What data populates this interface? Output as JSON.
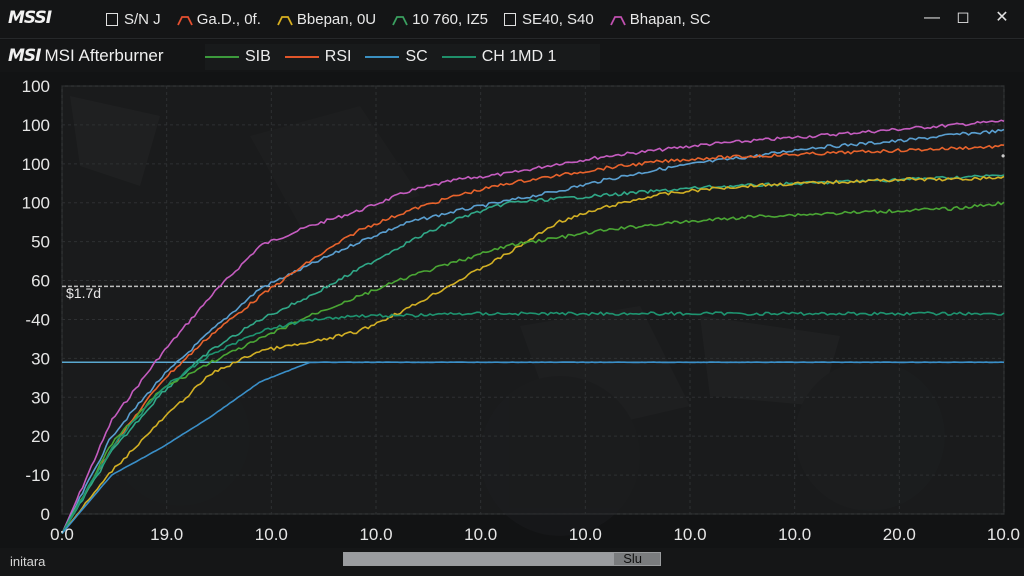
{
  "window": {
    "logo": "MSSI",
    "legend": [
      {
        "label": "S/N  J",
        "type": "box",
        "color": "#e0e0e0"
      },
      {
        "label": "Ga.D., 0f.",
        "type": "tick",
        "color": "#e65030"
      },
      {
        "label": "Bbepan, 0U",
        "type": "tick",
        "color": "#d8b020"
      },
      {
        "label": "10 760, IZ5",
        "type": "tick",
        "color": "#3aa060"
      },
      {
        "label": "SE40, S40",
        "type": "box",
        "color": "#e0e0e0"
      },
      {
        "label": "Bhapan, SC",
        "type": "tick",
        "color": "#c050b0"
      }
    ],
    "buttons": {
      "minimize": "—",
      "restore": "◻",
      "close": "✕"
    }
  },
  "subbar": {
    "brand_logo": "MSI",
    "brand_name": "MSI Afterburner",
    "legend": [
      {
        "label": "SIB",
        "color": "#3c9a3c"
      },
      {
        "label": "RSI",
        "color": "#e0552a"
      },
      {
        "label": "SC",
        "color": "#3a8fc0"
      },
      {
        "label": "CH   1MD 1",
        "color": "#1f8f6a"
      }
    ]
  },
  "chart_data": {
    "type": "line",
    "y_tick_labels": [
      "100",
      "100",
      "100",
      "100",
      "50",
      "60",
      "-40",
      "30",
      "30",
      "20",
      "-10",
      "0"
    ],
    "x_tick_labels": [
      "0:0",
      "19.0",
      "10.0",
      "10.0",
      "10.0",
      "10.0",
      "10.0",
      "10.0",
      "20.0",
      "10.0"
    ],
    "annotation": "$1.7d",
    "reference_lines": [
      {
        "label": "upper",
        "y_index": 5.15,
        "color": "#bdbdbd",
        "style": "dashed"
      },
      {
        "label": "lower",
        "y_index": 7.1,
        "color": "#5aa8d0",
        "style": "solid"
      }
    ],
    "grid": true,
    "series": [
      {
        "color": "#c55cc0",
        "y_index": [
          11.5,
          8.6,
          6.9,
          5.4,
          4.1,
          3.6,
          3.2,
          2.7,
          2.4,
          2.25,
          2.0,
          1.8,
          1.65,
          1.5,
          1.4,
          1.3,
          1.2,
          1.1,
          1.0,
          0.9
        ]
      },
      {
        "color": "#5a9fd0",
        "y_index": [
          11.5,
          9.0,
          7.5,
          6.3,
          5.2,
          4.6,
          4.0,
          3.5,
          3.2,
          2.95,
          2.7,
          2.4,
          2.15,
          1.95,
          1.8,
          1.6,
          1.5,
          1.4,
          1.25,
          1.15
        ]
      },
      {
        "color": "#e8632c",
        "y_index": [
          11.5,
          9.3,
          7.6,
          6.4,
          5.4,
          4.5,
          3.7,
          3.2,
          2.8,
          2.5,
          2.3,
          2.1,
          1.95,
          1.85,
          1.8,
          1.75,
          1.7,
          1.65,
          1.6,
          1.55
        ]
      },
      {
        "color": "#30a888",
        "y_index": [
          11.5,
          9.4,
          7.9,
          6.8,
          6.0,
          5.4,
          4.7,
          4.0,
          3.4,
          3.0,
          2.9,
          2.8,
          2.7,
          2.6,
          2.55,
          2.5,
          2.45,
          2.4,
          2.35,
          2.3
        ]
      },
      {
        "color": "#d2b024",
        "y_index": [
          11.5,
          9.9,
          8.6,
          7.4,
          6.8,
          6.6,
          6.3,
          5.7,
          5.0,
          4.3,
          3.5,
          3.1,
          2.8,
          2.65,
          2.55,
          2.5,
          2.45,
          2.4,
          2.4,
          2.35
        ]
      },
      {
        "color": "#4aa634",
        "y_index": [
          11.5,
          9.2,
          7.8,
          7.1,
          6.5,
          5.9,
          5.4,
          4.9,
          4.5,
          4.1,
          3.9,
          3.7,
          3.55,
          3.45,
          3.35,
          3.3,
          3.25,
          3.2,
          3.15,
          3.0
        ]
      },
      {
        "color": "#1e9470",
        "y_index": [
          11.5,
          9.3,
          7.8,
          6.9,
          6.3,
          6.0,
          5.9,
          5.9,
          5.85,
          5.85,
          5.85,
          5.85,
          5.85,
          5.85,
          5.85,
          5.85,
          5.85,
          5.85,
          5.85,
          5.85
        ]
      },
      {
        "color": "#3a8fc8",
        "y_index": [
          11.5,
          10.0,
          9.3,
          8.5,
          7.6,
          7.1,
          7.1,
          7.1,
          7.1,
          7.1,
          7.1,
          7.1,
          7.1,
          7.1,
          7.1,
          7.1,
          7.1,
          7.1,
          7.1,
          7.1
        ]
      }
    ]
  },
  "bottom": {
    "status": "initara",
    "scroll_label": "Slu"
  }
}
